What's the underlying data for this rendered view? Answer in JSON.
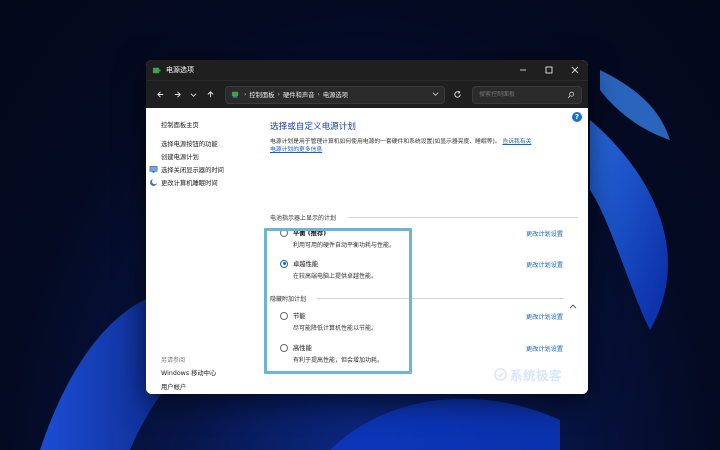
{
  "window": {
    "title": "电源选项"
  },
  "nav": {
    "breadcrumbs": [
      "控制面板",
      "硬件和声音",
      "电源选项"
    ],
    "search_placeholder": "搜索控制面板"
  },
  "left_pane": {
    "items": [
      {
        "label": "控制面板主页"
      },
      {
        "label": "选择电源按钮的功能"
      },
      {
        "label": "创建电源计划"
      },
      {
        "label": "选择关闭显示器的时间"
      },
      {
        "label": "更改计算机睡眠时间"
      }
    ],
    "see_also": "另请参阅",
    "see_also_items": [
      "Windows 移动中心",
      "用户帐户"
    ]
  },
  "main": {
    "title": "选择或自定义电源计划",
    "description": "电源计划是用于管理计算机如何使用电源的一套硬件和系统设置(如显示器亮度、睡眠等)。",
    "description_link_a": "告诉我有关",
    "description_link_b": "电源计划的更多信息",
    "section_shown": "电池指示器上显示的计划",
    "section_hidden": "隐藏附加计划",
    "change_label": "更改计划设置",
    "plans": [
      {
        "name": "平衡 (推荐)",
        "desc": "利用可用的硬件自动平衡功耗与性能。",
        "selected": false
      },
      {
        "name": "卓越性能",
        "desc": "在较高端电脑上提供卓越性能。",
        "selected": true
      },
      {
        "name": "节能",
        "desc": "尽可能降低计算机性能以节能。",
        "selected": false
      },
      {
        "name": "高性能",
        "desc": "有利于提高性能，但会增加功耗。",
        "selected": false
      }
    ]
  },
  "watermark": {
    "text": "系统极客"
  }
}
